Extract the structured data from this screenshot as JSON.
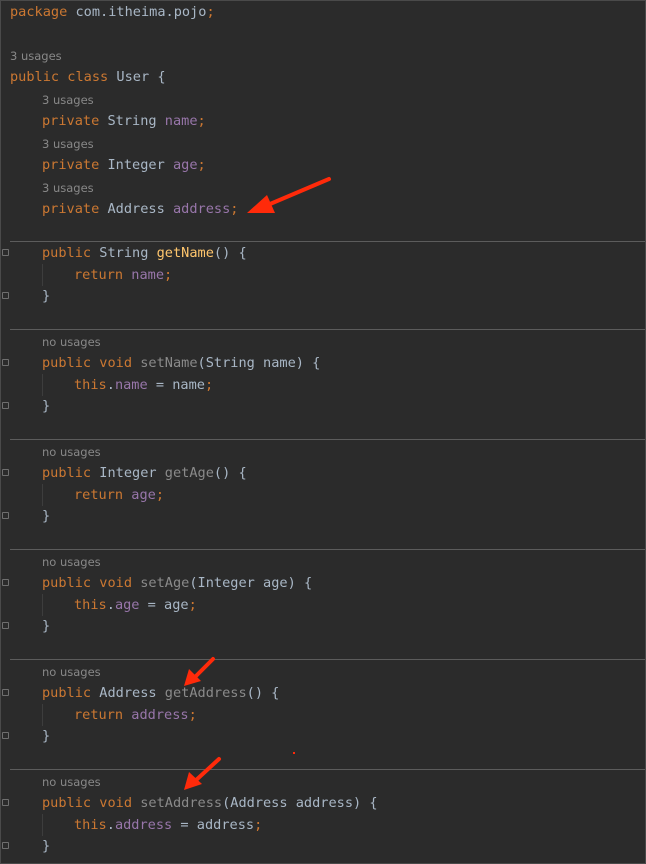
{
  "colors": {
    "background": "#2b2b2b",
    "keyword": "#cc7832",
    "method": "#ffc66d",
    "unused_method": "#8a8a8a",
    "field": "#9876aa",
    "text": "#a9b7c6",
    "hint": "#888888",
    "arrow": "#ff2a0a"
  },
  "code": {
    "package_kw": "package",
    "package_name": "com.itheima.pojo",
    "class_usages": "3 usages",
    "class_decl": {
      "kw1": "public",
      "kw2": "class",
      "name": "User",
      "brace": "{"
    },
    "fields": [
      {
        "usages": "3 usages",
        "kw": "private",
        "type": "String",
        "name": "name"
      },
      {
        "usages": "3 usages",
        "kw": "private",
        "type": "Integer",
        "name": "age"
      },
      {
        "usages": "3 usages",
        "kw": "private",
        "type": "Address",
        "name": "address"
      }
    ],
    "methods": [
      {
        "usages": "",
        "sig_kw": "public",
        "ret": "String",
        "name": "getName",
        "params_open": "(",
        "param_type": "",
        "param_name": "",
        "params_close": ") {",
        "body_kw": "return",
        "body_field": "name",
        "body_rest": ""
      },
      {
        "usages": "no usages",
        "sig_kw": "public",
        "ret": "void",
        "name": "setName",
        "params_open": "(",
        "param_type": "String",
        "param_name": "name",
        "params_close": ") {",
        "body_kw": "this",
        "body_field": "name",
        "body_rest": " = name"
      },
      {
        "usages": "no usages",
        "sig_kw": "public",
        "ret": "Integer",
        "name": "getAge",
        "params_open": "(",
        "param_type": "",
        "param_name": "",
        "params_close": ") {",
        "body_kw": "return",
        "body_field": "age",
        "body_rest": ""
      },
      {
        "usages": "no usages",
        "sig_kw": "public",
        "ret": "void",
        "name": "setAge",
        "params_open": "(",
        "param_type": "Integer",
        "param_name": "age",
        "params_close": ") {",
        "body_kw": "this",
        "body_field": "age",
        "body_rest": " = age"
      },
      {
        "usages": "no usages",
        "sig_kw": "public",
        "ret": "Address",
        "name": "getAddress",
        "params_open": "(",
        "param_type": "",
        "param_name": "",
        "params_close": ") {",
        "body_kw": "return",
        "body_field": "address",
        "body_rest": ""
      },
      {
        "usages": "no usages",
        "sig_kw": "public",
        "ret": "void",
        "name": "setAddress",
        "params_open": "(",
        "param_type": "Address",
        "param_name": "address",
        "params_close": ") {",
        "body_kw": "this",
        "body_field": "address",
        "body_rest": " = address"
      }
    ],
    "semicolon": ";",
    "close_brace": "}"
  },
  "annotations": [
    {
      "name": "arrow-address-field"
    },
    {
      "name": "arrow-get-address"
    },
    {
      "name": "arrow-set-address"
    }
  ]
}
